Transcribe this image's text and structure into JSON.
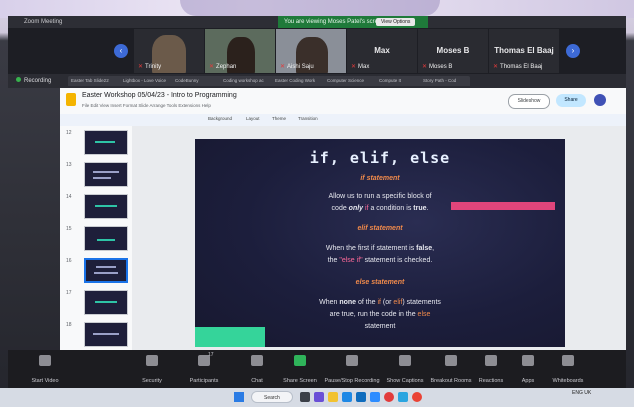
{
  "zoom": {
    "window_title": "Zoom Meeting",
    "banner": "You are viewing Moses Patel's screen",
    "view_options": "View Options",
    "recording": "Recording",
    "participants": [
      {
        "name": "Trinity"
      },
      {
        "name": "Zephan"
      },
      {
        "name": "Aishi Saju"
      },
      {
        "name": "Max",
        "label": "Max"
      },
      {
        "name": "Moses B",
        "label": "Moses B"
      },
      {
        "name": "Thomas El Baaj",
        "label": "Thomas El Baaj"
      }
    ],
    "controls": [
      {
        "id": "start-video",
        "label": "Start Video"
      },
      {
        "id": "security",
        "label": "Security"
      },
      {
        "id": "participants",
        "label": "Participants",
        "count": "17"
      },
      {
        "id": "chat",
        "label": "Chat"
      },
      {
        "id": "share-screen",
        "label": "Share Screen"
      },
      {
        "id": "pause-recording",
        "label": "Pause/Stop Recording"
      },
      {
        "id": "captions",
        "label": "Show Captions"
      },
      {
        "id": "breakout",
        "label": "Breakout Rooms"
      },
      {
        "id": "reactions",
        "label": "Reactions"
      },
      {
        "id": "apps",
        "label": "Apps"
      },
      {
        "id": "whiteboards",
        "label": "Whiteboards"
      }
    ]
  },
  "browser": {
    "tabs": [
      "Easter Tab Slide22",
      "Lightbox - Love Voice",
      "CodeBunny",
      "Coding workshop ac",
      "Easter Coding Work",
      "Computer Science",
      "Compute It",
      "Story Path - Cod"
    ]
  },
  "slides_app": {
    "doc_title": "Easter Workshop 05/04/23 - Intro to Programming",
    "menu": "File  Edit  View  Insert  Format  Slide  Arrange  Tools  Extensions  Help",
    "slideshow": "Slideshow",
    "share": "Share",
    "toolbar": {
      "background": "Background",
      "layout": "Layout",
      "theme": "Theme",
      "transition": "Transition"
    },
    "thumb_numbers": [
      "12",
      "13",
      "14",
      "15",
      "16",
      "17",
      "18"
    ]
  },
  "slide": {
    "title": "if, elif, else",
    "if_heading": "if statement",
    "if_body_1": "Allow us to run a specific block of",
    "if_body_2a": "code ",
    "if_body_2b": "only",
    "if_body_2c": " if",
    "if_body_2d": " a condition is ",
    "if_body_2e": "true",
    "if_body_2f": ".",
    "elif_heading": "elif statement",
    "elif_body_1a": "When the first if statement is ",
    "elif_body_1b": "false",
    "elif_body_1c": ",",
    "elif_body_2a": "the ",
    "elif_body_2b": "\"else if\"",
    "elif_body_2c": " statement is checked.",
    "else_heading": "else statement",
    "else_body_1a": "When ",
    "else_body_1b": "none",
    "else_body_1c": " of the ",
    "else_body_1d": "if",
    "else_body_1e": " (or ",
    "else_body_1f": "elif",
    "else_body_1g": ") statements",
    "else_body_2a": "are true, run the code in the ",
    "else_body_2b": "else",
    "else_body_3": "statement"
  },
  "taskbar": {
    "search": "Search",
    "lang": "ENG UK"
  },
  "colors": {
    "accent_orange": "#f08a4b",
    "accent_pink": "#e0457b",
    "accent_green": "#35d49a",
    "zoom_green": "#1f7a3a"
  }
}
